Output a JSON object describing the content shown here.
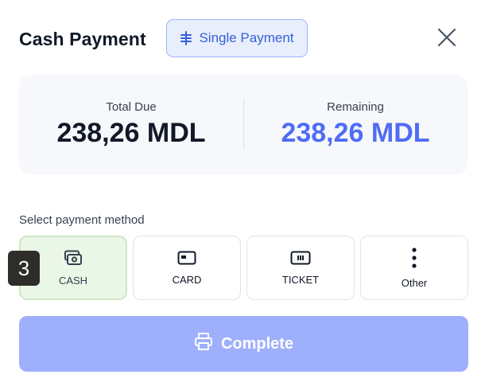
{
  "header": {
    "title": "Cash Payment",
    "mode_badge": {
      "label": "Single Payment",
      "icon": "equals-list-icon"
    },
    "close_icon": "close-icon"
  },
  "summary": {
    "total_due": {
      "label": "Total Due",
      "value": "238,26 MDL"
    },
    "remaining": {
      "label": "Remaining",
      "value": "238,26 MDL"
    }
  },
  "payment_methods": {
    "label": "Select payment method",
    "selected": "CASH",
    "items": [
      {
        "label": "CASH",
        "icon": "cash-icon"
      },
      {
        "label": "CARD",
        "icon": "card-icon"
      },
      {
        "label": "TICKET",
        "icon": "ticket-icon"
      },
      {
        "label": "Other",
        "icon": "more-vertical-icon"
      }
    ]
  },
  "overlay_badge": {
    "text": "3"
  },
  "complete_button": {
    "label": "Complete",
    "icon": "printer-icon",
    "enabled": false
  },
  "colors": {
    "accent": "#4f6cf5",
    "badge_border": "#9fb6f3",
    "badge_bg": "#e8eefc",
    "selected_bg": "#eaf6e6",
    "complete_bg": "#9eaffc"
  }
}
